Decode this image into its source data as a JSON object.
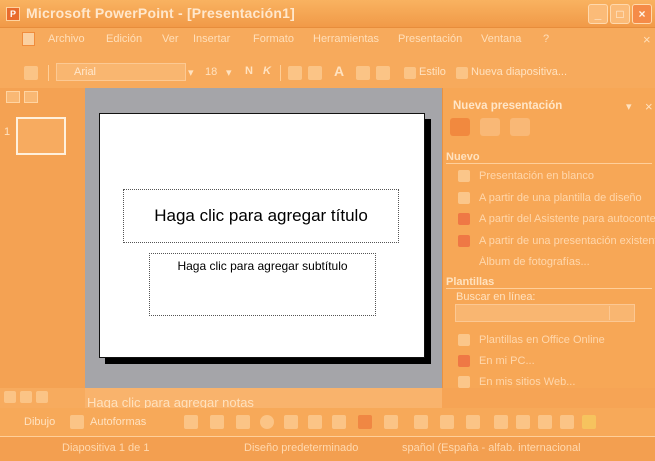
{
  "window": {
    "title": "Microsoft PowerPoint - [Presentación1]",
    "app_icon": "powerpoint-app-icon",
    "controls": [
      "minimize-icon",
      "maximize-icon",
      "close-icon"
    ]
  },
  "menu": {
    "items": [
      "Archivo",
      "Edición",
      "Ver",
      "Insertar",
      "Formato",
      "Herramientas",
      "Presentación",
      "Ventana",
      "?"
    ],
    "close_doc": "×"
  },
  "toolbar": {
    "font_name": "Arial",
    "font_size": "18",
    "bold_label": "N",
    "italic_label": "K",
    "style_label": "Estilo",
    "new_slide_label": "Nueva diapositiva..."
  },
  "slides_pane": {
    "thumb_number": "1"
  },
  "slide": {
    "title_placeholder": "Haga clic para agregar título",
    "subtitle_placeholder": "Haga clic para agregar subtítulo"
  },
  "task_pane": {
    "title": "Nueva presentación",
    "new_section": "Nuevo",
    "new_items": [
      "Presentación en blanco",
      "A partir de una plantilla de diseño",
      "A partir del Asistente para autocontenido",
      "A partir de una presentación existente",
      "Álbum de fotografías..."
    ],
    "templates_section": "Plantillas",
    "search_label": "Buscar en línea:",
    "template_items": [
      "Plantillas en Office Online",
      "En mi PC...",
      "En mis sitios Web..."
    ]
  },
  "notes": {
    "placeholder": "Haga clic para agregar notas"
  },
  "drawing": {
    "draw_label": "Dibujo",
    "autoshapes_label": "Autoformas"
  },
  "status": {
    "slide_info": "Diapositiva 1 de 1",
    "design": "Diseño predeterminado",
    "language": "spañol (España - alfab. internacional"
  },
  "colors": {
    "overlay": "#f6a455",
    "slide_background": "#ffffff",
    "slide_area": "#a5a5a9"
  }
}
